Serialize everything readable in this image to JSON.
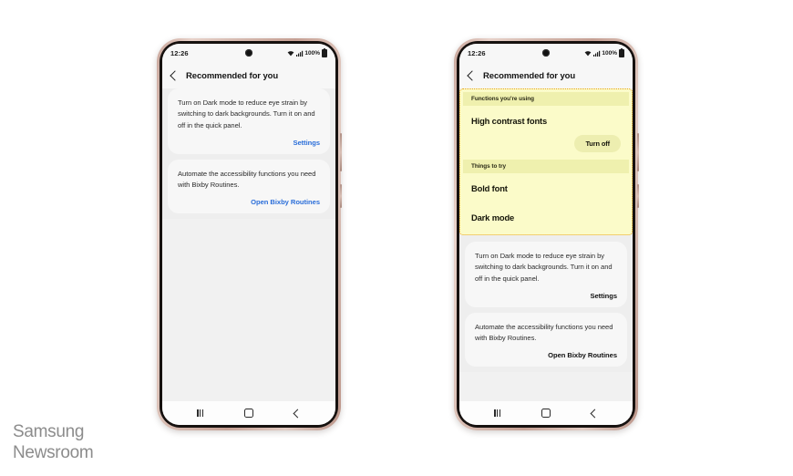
{
  "watermark": {
    "line1": "Samsung",
    "line2": "Newsroom"
  },
  "phones": {
    "left": {
      "status_bar": {
        "time": "12:26",
        "battery_percent": "100%",
        "wifi_icon": "wifi-icon",
        "signal_icon": "signal-bars-icon",
        "battery_icon": "battery-full-icon",
        "camera": "front-camera-punch-hole"
      },
      "app_bar": {
        "back_icon": "back-chevron-icon",
        "title": "Recommended for you"
      },
      "cards": [
        {
          "body": "Turn on Dark mode to reduce eye strain by switching to dark backgrounds. Turn it on and off in the quick panel.",
          "action_label": "Settings",
          "action_color": "#2b6ed9"
        },
        {
          "body": "Automate the accessibility functions you need with Bixby Routines.",
          "action_label": "Open Bixby Routines",
          "action_color": "#2b6ed9"
        }
      ],
      "nav_bar": {
        "recents_icon": "recent-apps-icon",
        "home_icon": "home-icon",
        "back_icon": "back-icon"
      }
    },
    "right": {
      "status_bar": {
        "time": "12:26",
        "battery_percent": "100%",
        "wifi_icon": "wifi-icon",
        "signal_icon": "signal-bars-icon",
        "battery_icon": "battery-full-icon",
        "camera": "front-camera-punch-hole"
      },
      "app_bar": {
        "back_icon": "back-chevron-icon",
        "title": "Recommended for you"
      },
      "highlight": {
        "border_color": "#e8a317",
        "background_color": "#fbfbc9",
        "header_background_color": "#eff0ae",
        "sections": [
          {
            "header": "Functions you're using",
            "items": [
              {
                "label": "High contrast fonts",
                "button_label": "Turn off"
              }
            ]
          },
          {
            "header": "Things to try",
            "items": [
              {
                "label": "Bold font"
              },
              {
                "label": "Dark mode"
              }
            ]
          }
        ]
      },
      "cards": [
        {
          "body": "Turn on Dark mode to reduce eye strain by switching to dark backgrounds. Turn it on and off in the quick panel.",
          "action_label": "Settings",
          "action_color": "#111111"
        },
        {
          "body": "Automate the accessibility functions you need with Bixby Routines.",
          "action_label": "Open Bixby Routines",
          "action_color": "#111111"
        }
      ],
      "nav_bar": {
        "recents_icon": "recent-apps-icon",
        "home_icon": "home-icon",
        "back_icon": "back-icon"
      }
    }
  }
}
